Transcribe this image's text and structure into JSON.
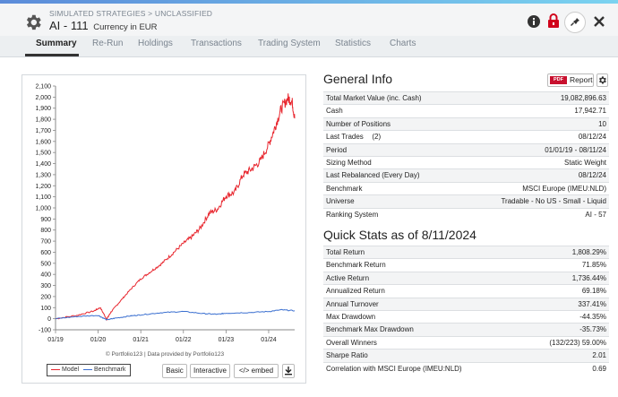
{
  "header": {
    "breadcrumb": "SIMULATED STRATEGIES > UNCLASSIFIED",
    "title": "AI - 111",
    "subtitle": "Currency in EUR"
  },
  "tabs": [
    "Summary",
    "Re-Run",
    "Holdings",
    "Transactions",
    "Trading System",
    "Statistics",
    "Charts"
  ],
  "active_tab": "Summary",
  "chart": {
    "credit": "© Portfolio123 | Data provided by Portfolio123",
    "legend": [
      {
        "name": "Model",
        "color": "#e8272f"
      },
      {
        "name": "Benchmark",
        "color": "#3a6fd0"
      }
    ],
    "buttons": {
      "basic": "Basic",
      "interactive": "Interactive",
      "embed": "</> embed"
    }
  },
  "chart_data": {
    "type": "line",
    "x_ticks": [
      "01/19",
      "01/20",
      "01/21",
      "01/22",
      "01/23",
      "01/24"
    ],
    "y_ticks": [
      -100,
      0,
      100,
      200,
      300,
      400,
      500,
      600,
      700,
      800,
      900,
      1000,
      1100,
      1200,
      1300,
      1400,
      1500,
      1600,
      1700,
      1800,
      1900,
      2000,
      2100
    ],
    "y_tick_labels": [
      "-100",
      "0",
      "100",
      "200",
      "300",
      "400",
      "500",
      "600",
      "700",
      "800",
      "900",
      "1,000",
      "1,100",
      "1,200",
      "1,300",
      "1,400",
      "1,500",
      "1,600",
      "1,700",
      "1,800",
      "1,900",
      "2,000",
      "2,100"
    ],
    "ylim": [
      -100,
      2100
    ],
    "x_range": [
      "2019-01-01",
      "2024-08-11"
    ],
    "series": [
      {
        "name": "Model",
        "color": "#e8272f",
        "x": [
          2019.0,
          2019.5,
          2019.9,
          2020.05,
          2020.2,
          2020.3,
          2020.5,
          2020.75,
          2021.0,
          2021.25,
          2021.5,
          2021.75,
          2022.0,
          2022.2,
          2022.4,
          2022.6,
          2022.8,
          2023.0,
          2023.2,
          2023.4,
          2023.6,
          2023.8,
          2024.0,
          2024.15,
          2024.3,
          2024.45,
          2024.55,
          2024.61
        ],
        "y": [
          0,
          30,
          70,
          100,
          -5,
          60,
          150,
          260,
          360,
          430,
          500,
          590,
          680,
          740,
          820,
          950,
          990,
          1110,
          1140,
          1300,
          1350,
          1420,
          1570,
          1730,
          1900,
          1990,
          1960,
          1808
        ]
      },
      {
        "name": "Benchmark",
        "color": "#3a6fd0",
        "x": [
          2019.0,
          2019.5,
          2020.0,
          2020.2,
          2020.4,
          2020.75,
          2021.0,
          2021.5,
          2022.0,
          2022.5,
          2022.8,
          2023.0,
          2023.5,
          2024.0,
          2024.3,
          2024.61
        ],
        "y": [
          0,
          20,
          30,
          -10,
          5,
          25,
          35,
          55,
          65,
          45,
          40,
          50,
          55,
          65,
          80,
          72
        ]
      }
    ]
  },
  "general_info": {
    "title": "General Info",
    "report_label": "Report",
    "pdf_label": "PDF",
    "rows": [
      {
        "label": "Total Market Value (inc. Cash)",
        "value": "19,082,896.63",
        "link": false
      },
      {
        "label": "Cash",
        "value": "17,942.71",
        "link": false
      },
      {
        "label": "Number of Positions",
        "value": "10",
        "link": true,
        "value_link": true
      },
      {
        "label": "Last Trades",
        "suffix": "(2)",
        "value": "08/12/24",
        "link": true,
        "value_link": true
      },
      {
        "label": "Period",
        "value": "01/01/19 - 08/11/24",
        "link": false
      },
      {
        "label": "Sizing Method",
        "value": "Static Weight",
        "link": false
      },
      {
        "label": "Last Rebalanced (Every Day)",
        "value": "08/12/24",
        "link": false
      },
      {
        "label": "Benchmark",
        "value": "MSCI Europe (IMEU:NLD)",
        "link": false
      },
      {
        "label": "Universe",
        "value": "Tradable - No US - Small - Liquid",
        "link": false,
        "value_link": true
      },
      {
        "label": "Ranking System",
        "value": "AI - 57",
        "link": false,
        "value_link": true
      }
    ]
  },
  "quick_stats": {
    "title": "Quick Stats as of 8/11/2024",
    "rows": [
      {
        "label": "Total Return",
        "value": "1,808.29%",
        "neg": false
      },
      {
        "label": "Benchmark Return",
        "value": "71.85%",
        "neg": false
      },
      {
        "label": "Active Return",
        "value": "1,736.44%",
        "neg": false
      },
      {
        "label": "Annualized Return",
        "value": "69.18%",
        "neg": false
      },
      {
        "label": "Annual Turnover",
        "value": "337.41%",
        "neg": false
      },
      {
        "label": "Max Drawdown",
        "value": "-44.35%",
        "neg": true
      },
      {
        "label": "Benchmark Max Drawdown",
        "value": "-35.73%",
        "neg": true
      },
      {
        "label": "Overall Winners",
        "value": "(132/223) 59.00%",
        "neg": false
      },
      {
        "label": "Sharpe Ratio",
        "value": "2.01",
        "neg": false
      },
      {
        "label": "Correlation with MSCI Europe (IMEU:NLD)",
        "value": "0.69",
        "neg": false
      }
    ]
  }
}
